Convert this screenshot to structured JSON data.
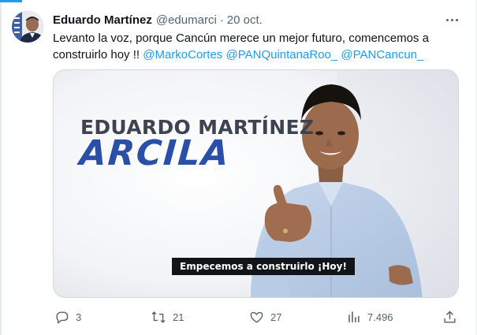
{
  "author": {
    "name": "Eduardo Martínez",
    "handle": "@edumarci",
    "separator": "·",
    "date": "20 oct."
  },
  "tweet": {
    "line1": "Levanto la voz, porque Cancún merece un mejor futuro, comencemos a",
    "line2_prefix": "construirlo hoy !! ",
    "mentions": [
      "@MarkoCortes",
      "@PANQuintanaRoo_",
      "@PANCancun_"
    ]
  },
  "media": {
    "first_name": "EDUARDO MARTÍNEZ",
    "last_name": "ARCILA",
    "caption": "Empecemos a construirlo ¡Hoy!"
  },
  "actions": {
    "replies": "3",
    "retweets": "21",
    "likes": "27",
    "views": "7.496"
  },
  "icons": {
    "more": "more-horizontal-icon",
    "reply": "reply-icon",
    "retweet": "retweet-icon",
    "like": "heart-icon",
    "views": "views-chart-icon",
    "share": "share-icon"
  },
  "colors": {
    "text": "#0f1419",
    "muted": "#536471",
    "link": "#1d9bf0",
    "name_blue": "#2a4fa8"
  }
}
